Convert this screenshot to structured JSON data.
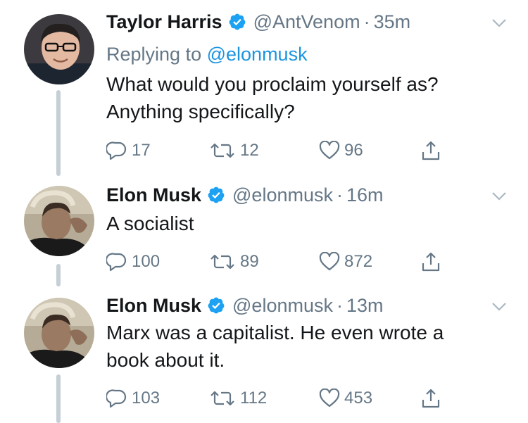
{
  "colors": {
    "accent": "#1b95e0",
    "muted": "#657786",
    "text": "#14171a",
    "thread": "#c4cfd6"
  },
  "icons": {
    "verified": "verified-badge-icon",
    "caret": "chevron-down-icon",
    "reply": "reply-icon",
    "retweet": "retweet-icon",
    "like": "heart-icon",
    "share": "share-icon"
  },
  "tweets": [
    {
      "name": "Taylor Harris",
      "handle": "@AntVenom",
      "dot": "·",
      "time": "35m",
      "replying_prefix": "Replying to",
      "replying_to": "@elonmusk",
      "text_line1": "What would you proclaim yourself as?",
      "text_line2": "Anything specifically?",
      "replies": "17",
      "retweets": "12",
      "likes": "96"
    },
    {
      "name": "Elon Musk",
      "handle": "@elonmusk",
      "dot": "·",
      "time": "16m",
      "text_line1": "A socialist",
      "replies": "100",
      "retweets": "89",
      "likes": "872"
    },
    {
      "name": "Elon Musk",
      "handle": "@elonmusk",
      "dot": "·",
      "time": "13m",
      "text_line1": "Marx was a capitalist. He even wrote a",
      "text_line2": "book about it.",
      "replies": "103",
      "retweets": "112",
      "likes": "453"
    }
  ]
}
